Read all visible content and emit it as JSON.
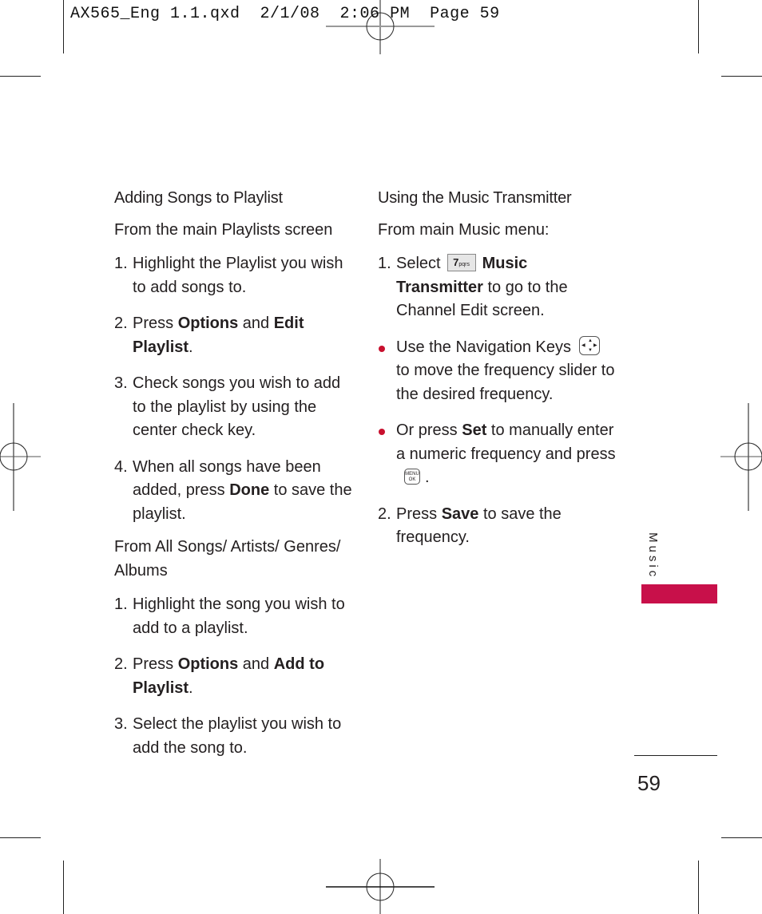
{
  "slug_line": "AX565_Eng 1.1.qxd  2/1/08  2:06 PM  Page 59",
  "left_column": {
    "heading": "Adding Songs to Playlist",
    "section1": {
      "subheading": "From the main Playlists screen",
      "steps": [
        {
          "num": "1.",
          "parts": [
            {
              "t": "Highlight the Playlist you wish to add songs to.",
              "b": false
            }
          ]
        },
        {
          "num": "2.",
          "parts": [
            {
              "t": "Press ",
              "b": false
            },
            {
              "t": "Options",
              "b": true
            },
            {
              "t": " and ",
              "b": false
            },
            {
              "t": "Edit Playlist",
              "b": true
            },
            {
              "t": ".",
              "b": false
            }
          ]
        },
        {
          "num": "3.",
          "parts": [
            {
              "t": "Check songs you wish to add to the playlist by using the center check key.",
              "b": false
            }
          ]
        },
        {
          "num": "4.",
          "parts": [
            {
              "t": "When all songs have been added, press ",
              "b": false
            },
            {
              "t": "Done",
              "b": true
            },
            {
              "t": " to save the playlist.",
              "b": false
            }
          ]
        }
      ]
    },
    "section2": {
      "subheading": "From All Songs/ Artists/ Genres/ Albums",
      "steps": [
        {
          "num": "1.",
          "parts": [
            {
              "t": "Highlight the song you wish to add to a playlist.",
              "b": false
            }
          ]
        },
        {
          "num": "2.",
          "parts": [
            {
              "t": "Press ",
              "b": false
            },
            {
              "t": "Options",
              "b": true
            },
            {
              "t": " and ",
              "b": false
            },
            {
              "t": "Add to Playlist",
              "b": true
            },
            {
              "t": ".",
              "b": false
            }
          ]
        },
        {
          "num": "3.",
          "parts": [
            {
              "t": "Select the playlist you wish to add the song to.",
              "b": false
            }
          ]
        }
      ]
    }
  },
  "right_column": {
    "heading": "Using the Music Transmitter",
    "subheading": "From main Music menu:",
    "step1": {
      "num": "1.",
      "before": "Select",
      "key_digit": "7",
      "key_letters": "pqrs",
      "bold": "Music Transmitter",
      "after": " to go to the Channel Edit screen."
    },
    "bullets": [
      {
        "before": "Use the Navigation Keys",
        "after": "to move the frequency slider to the desired frequency.",
        "icon": "navigation-keys-icon"
      },
      {
        "before": "Or press ",
        "bold": "Set",
        "middle": " to manually enter a numeric frequency and press",
        "after": ".",
        "icon": "menu-ok-key-icon",
        "key_top": "MENU",
        "key_bottom": "OK"
      }
    ],
    "step2": {
      "num": "2.",
      "before": "Press ",
      "bold": "Save",
      "after": " to save the frequency."
    }
  },
  "side_tab": {
    "label": "Music",
    "color": "#c8104a"
  },
  "page_number": "59",
  "colors": {
    "accent": "#c8104a",
    "bullet": "#c8102e",
    "text": "#231f20"
  }
}
